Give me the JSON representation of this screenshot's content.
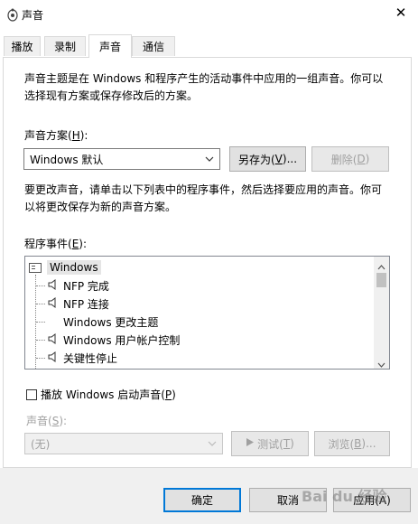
{
  "window": {
    "title": "声音",
    "close_glyph": "✕"
  },
  "tabs": [
    {
      "label": "播放"
    },
    {
      "label": "录制"
    },
    {
      "label": "声音"
    },
    {
      "label": "通信"
    }
  ],
  "intro": {
    "line1": "声音主题是在 Windows 和程序产生的活动事件中应用的一组声音。你可以",
    "line2": "选择现有方案或保存修改后的方案。"
  },
  "scheme": {
    "label": "声音方案(",
    "label_key": "H",
    "label_end": "):",
    "selected": "Windows 默认",
    "save_as": {
      "text": "另存为(",
      "key": "V",
      "end": ")..."
    },
    "delete": {
      "text": "删除(",
      "key": "D",
      "end": ")"
    }
  },
  "change_desc": {
    "line1": "要更改声音，请单击以下列表中的程序事件，然后选择要应用的声音。你可",
    "line2": "以将更改保存为新的声音方案。"
  },
  "events": {
    "label": "程序事件(",
    "label_key": "E",
    "label_end": "):",
    "items": [
      {
        "label": "Windows",
        "icon": "window-icon",
        "has_sound": false
      },
      {
        "label": "NFP 完成",
        "icon": "speaker-icon",
        "has_sound": true
      },
      {
        "label": "NFP 连接",
        "icon": "speaker-icon",
        "has_sound": true
      },
      {
        "label": "Windows 更改主题",
        "icon": "none",
        "has_sound": false
      },
      {
        "label": "Windows 用户帐户控制",
        "icon": "speaker-icon",
        "has_sound": true
      },
      {
        "label": "关键性停止",
        "icon": "speaker-icon",
        "has_sound": true
      }
    ]
  },
  "startup": {
    "label": "播放 Windows 启动声音(",
    "key": "P",
    "end": ")",
    "checked": false
  },
  "sound": {
    "label": "声音(",
    "label_key": "S",
    "label_end": "):",
    "selected": "(无)",
    "test": {
      "text": "测试(",
      "key": "T",
      "end": ")"
    },
    "browse": {
      "text": "浏览(",
      "key": "B",
      "end": ")..."
    }
  },
  "footer": {
    "ok": "确定",
    "cancel": "取消",
    "apply": "应用(A)"
  },
  "watermark": "Bai du 经验"
}
